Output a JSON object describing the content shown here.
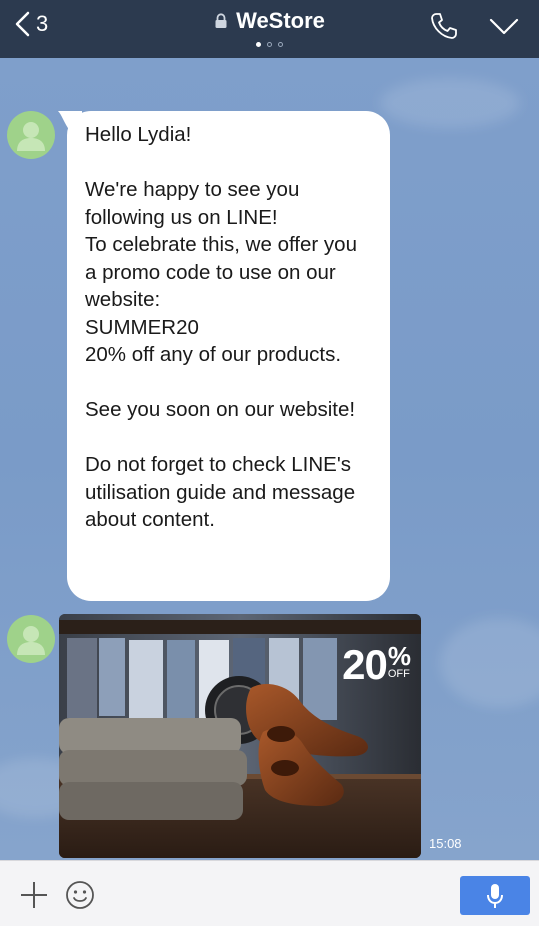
{
  "header": {
    "back_count": "3",
    "title": "WeStore",
    "page_dots": 3,
    "active_dot": 0,
    "icons": [
      "back-chevron-icon",
      "lock-icon",
      "phone-icon",
      "chevron-down-icon"
    ]
  },
  "messages": [
    {
      "type": "text",
      "sender_avatar": "default-user-avatar",
      "text": "Hello Lydia!\n\nWe're happy to see you following us on LINE!\nTo celebrate this, we offer you a promo code to use on our website:\nSUMMER20\n20% off any of our products.\n\nSee you soon on our website!\n\nDo not forget to check LINE's utilisation guide and message about content."
    },
    {
      "type": "image",
      "sender_avatar": "default-user-avatar",
      "image_description_icon": "shoes-promo-image",
      "promo_value": "20",
      "promo_percent": "%",
      "promo_off": "OFF",
      "time": "15:08"
    }
  ],
  "input_bar": {
    "placeholder": "",
    "icons": [
      "plus-icon",
      "emoji-icon",
      "microphone-icon"
    ]
  },
  "colors": {
    "header_bg": "#2c3a4f",
    "chat_bg": "#7c9cc7",
    "avatar_green": "#9fd28a",
    "mic_button": "#4a84e6"
  }
}
